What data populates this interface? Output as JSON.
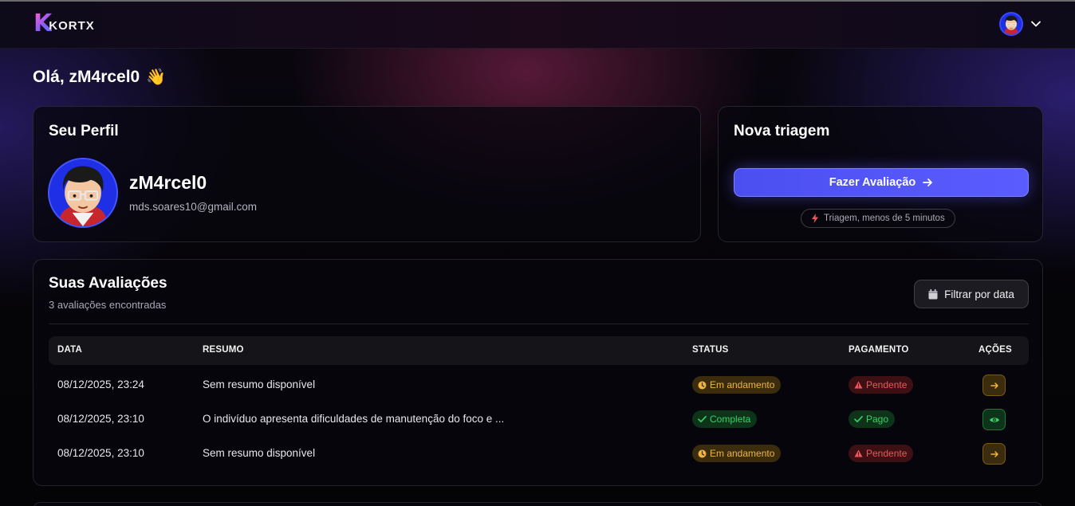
{
  "header": {
    "logo_mark": "K",
    "logo_text": "KORTX",
    "avatar_icon": "user-avatar",
    "menu_icon": "chevron-down-icon"
  },
  "greeting": {
    "text": "Olá, zM4rcel0",
    "emoji": "👋"
  },
  "profile": {
    "title": "Seu Perfil",
    "name": "zM4rcel0",
    "email": "mds.soares10@gmail.com"
  },
  "triage": {
    "title": "Nova triagem",
    "button_label": "Fazer Avaliação",
    "hint": "Triagem, menos de 5 minutos"
  },
  "evaluations": {
    "title": "Suas Avaliações",
    "count_text": "3 avaliações encontradas",
    "filter_label": "Filtrar por data",
    "columns": {
      "date": "DATA",
      "summary": "RESUMO",
      "status": "STATUS",
      "payment": "PAGAMENTO",
      "actions": "AÇÕES"
    },
    "rows": [
      {
        "date": "08/12/2025, 23:24",
        "summary": "Sem resumo disponível",
        "status": "Em andamento",
        "payment": "Pendente",
        "action_icon": "arrow-right-icon"
      },
      {
        "date": "08/12/2025, 23:10",
        "summary": "O indivíduo apresenta dificuldades de manutenção do foco e ...",
        "status": "Completa",
        "payment": "Pago",
        "action_icon": "eye-icon"
      },
      {
        "date": "08/12/2025, 23:10",
        "summary": "Sem resumo disponível",
        "status": "Em andamento",
        "payment": "Pendente",
        "action_icon": "arrow-right-icon"
      }
    ]
  },
  "colors": {
    "primary": "#5a5cff",
    "status_progress": "#f1b43b",
    "status_complete": "#35d16b",
    "payment_pending": "#f0545e"
  }
}
